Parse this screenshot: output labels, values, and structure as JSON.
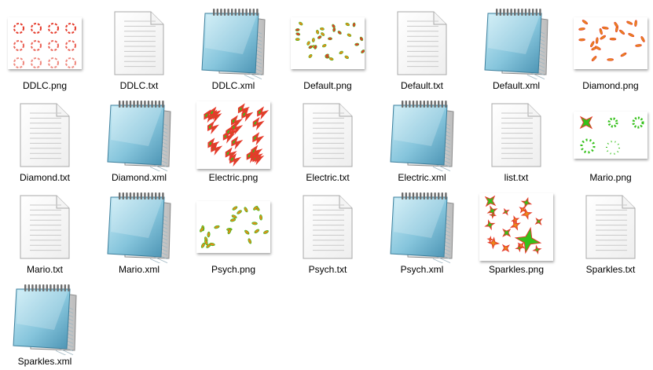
{
  "window": {
    "title": ""
  },
  "files": [
    {
      "name": "DDLC.png",
      "type": "png",
      "icon": "image-thumbnail-icon",
      "preview": "ddlc"
    },
    {
      "name": "DDLC.txt",
      "type": "txt",
      "icon": "text-document-icon"
    },
    {
      "name": "DDLC.xml",
      "type": "xml",
      "icon": "notepad-icon"
    },
    {
      "name": "Default.png",
      "type": "png",
      "icon": "image-thumbnail-icon",
      "preview": "default"
    },
    {
      "name": "Default.txt",
      "type": "txt",
      "icon": "text-document-icon"
    },
    {
      "name": "Default.xml",
      "type": "xml",
      "icon": "notepad-icon"
    },
    {
      "name": "Diamond.png",
      "type": "png",
      "icon": "image-thumbnail-icon",
      "preview": "diamond"
    },
    {
      "name": "Diamond.txt",
      "type": "txt",
      "icon": "text-document-icon"
    },
    {
      "name": "Diamond.xml",
      "type": "xml",
      "icon": "notepad-icon"
    },
    {
      "name": "Electric.png",
      "type": "png",
      "icon": "image-thumbnail-icon",
      "preview": "electric"
    },
    {
      "name": "Electric.txt",
      "type": "txt",
      "icon": "text-document-icon"
    },
    {
      "name": "Electric.xml",
      "type": "xml",
      "icon": "notepad-icon"
    },
    {
      "name": "list.txt",
      "type": "txt",
      "icon": "text-document-icon"
    },
    {
      "name": "Mario.png",
      "type": "png",
      "icon": "image-thumbnail-icon",
      "preview": "mario"
    },
    {
      "name": "Mario.txt",
      "type": "txt",
      "icon": "text-document-icon"
    },
    {
      "name": "Mario.xml",
      "type": "xml",
      "icon": "notepad-icon"
    },
    {
      "name": "Psych.png",
      "type": "png",
      "icon": "image-thumbnail-icon",
      "preview": "psych"
    },
    {
      "name": "Psych.txt",
      "type": "txt",
      "icon": "text-document-icon"
    },
    {
      "name": "Psych.xml",
      "type": "xml",
      "icon": "notepad-icon"
    },
    {
      "name": "Sparkles.png",
      "type": "png",
      "icon": "image-thumbnail-icon",
      "preview": "sparkles"
    },
    {
      "name": "Sparkles.txt",
      "type": "txt",
      "icon": "text-document-icon"
    },
    {
      "name": "Sparkles.xml",
      "type": "xml",
      "icon": "notepad-icon"
    }
  ],
  "colors": {
    "note_red": "#e53a2a",
    "note_green": "#35c11a",
    "note_orange": "#e8891b",
    "notepad_blue": "#8ccbe0",
    "page_border": "#a8a8a8"
  }
}
